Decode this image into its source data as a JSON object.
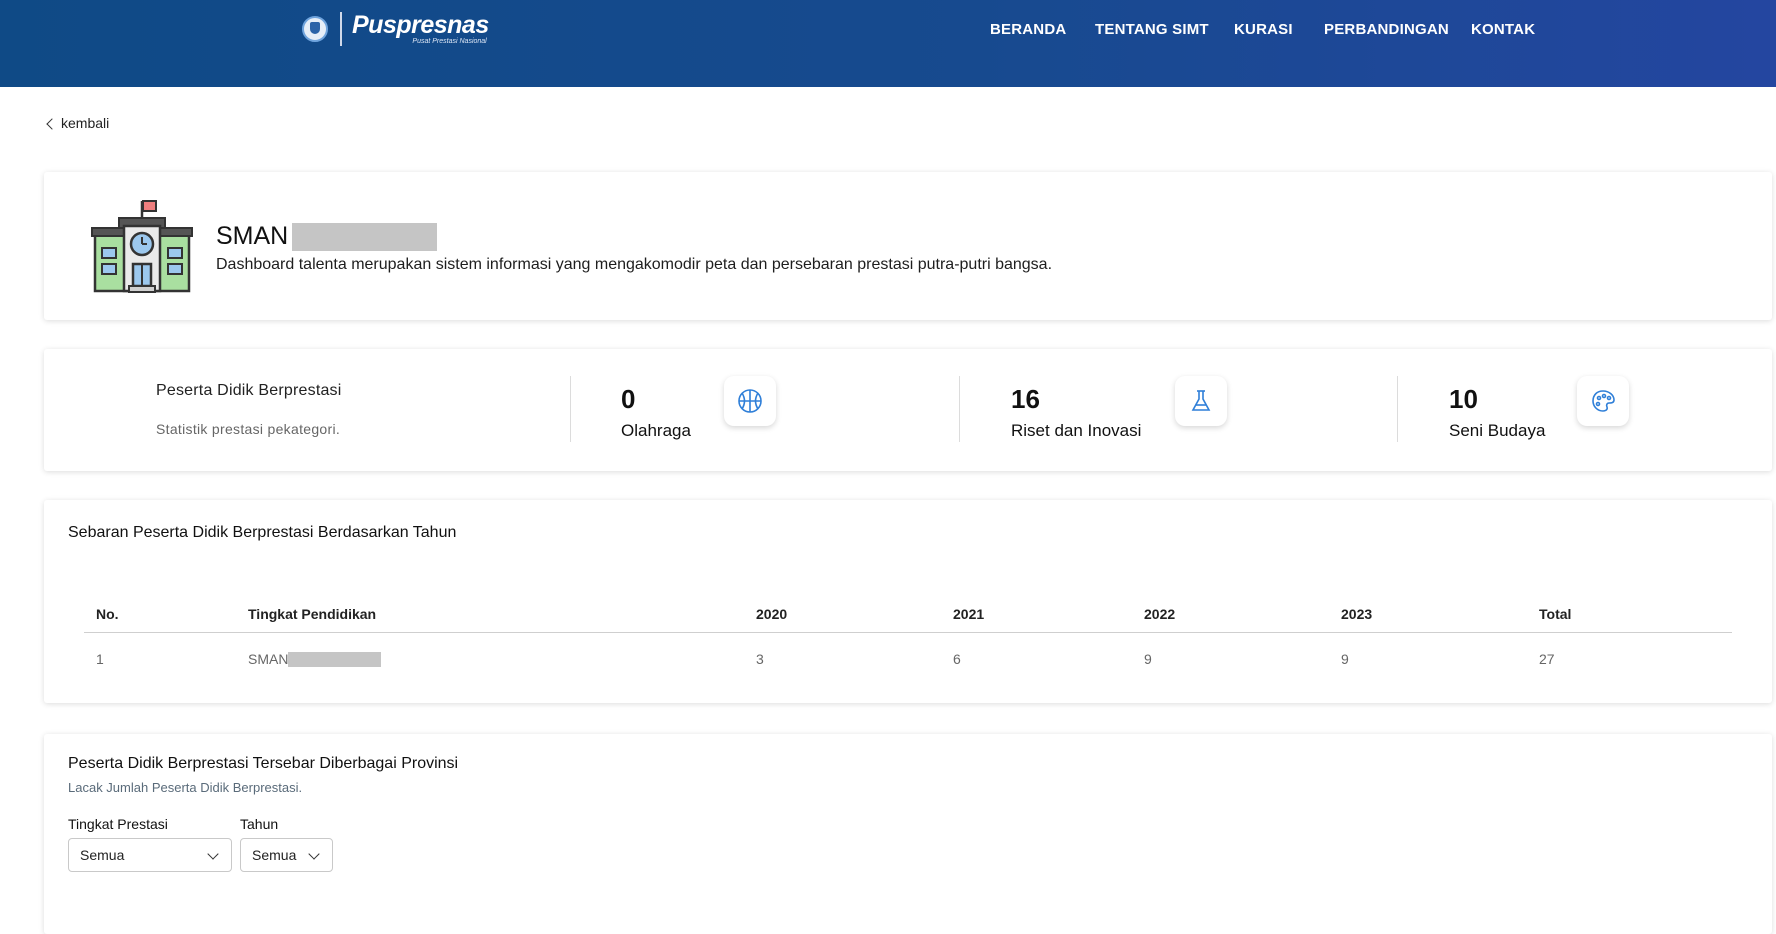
{
  "header": {
    "logo_text": "Puspresnas",
    "logo_subtext": "Pusat Prestasi Nasional",
    "nav": [
      "BERANDA",
      "TENTANG SIMT",
      "KURASI",
      "PERBANDINGAN",
      "KONTAK"
    ]
  },
  "back_label": "kembali",
  "profile": {
    "school_name": "SMAN",
    "description": "Dashboard talenta merupakan sistem informasi yang mengakomodir peta dan persebaran prestasi putra-putri bangsa."
  },
  "stats": {
    "title": "Peserta Didik Berprestasi",
    "subtitle": "Statistik prestasi pekategori.",
    "items": [
      {
        "value": "0",
        "label": "Olahraga",
        "icon": "basketball-icon"
      },
      {
        "value": "16",
        "label": "Riset dan Inovasi",
        "icon": "flask-icon"
      },
      {
        "value": "10",
        "label": "Seni Budaya",
        "icon": "art-palette-icon"
      }
    ]
  },
  "year_table": {
    "title": "Sebaran Peserta Didik Berprestasi Berdasarkan Tahun",
    "columns": [
      "No.",
      "Tingkat Pendidikan",
      "2020",
      "2021",
      "2022",
      "2023",
      "Total"
    ],
    "rows": [
      [
        "1",
        "SMAN",
        "3",
        "6",
        "9",
        "9",
        "27"
      ]
    ]
  },
  "province": {
    "title": "Peserta Didik Berprestasi Tersebar Diberbagai Provinsi",
    "subtitle": "Lacak Jumlah Peserta Didik Berprestasi.",
    "filters": [
      {
        "label": "Tingkat Prestasi",
        "value": "Semua"
      },
      {
        "label": "Tahun",
        "value": "Semua"
      }
    ]
  },
  "colors": {
    "header_start": "#0f4a86",
    "header_end": "#2446a0",
    "icon_blue": "#2f7fd8"
  }
}
